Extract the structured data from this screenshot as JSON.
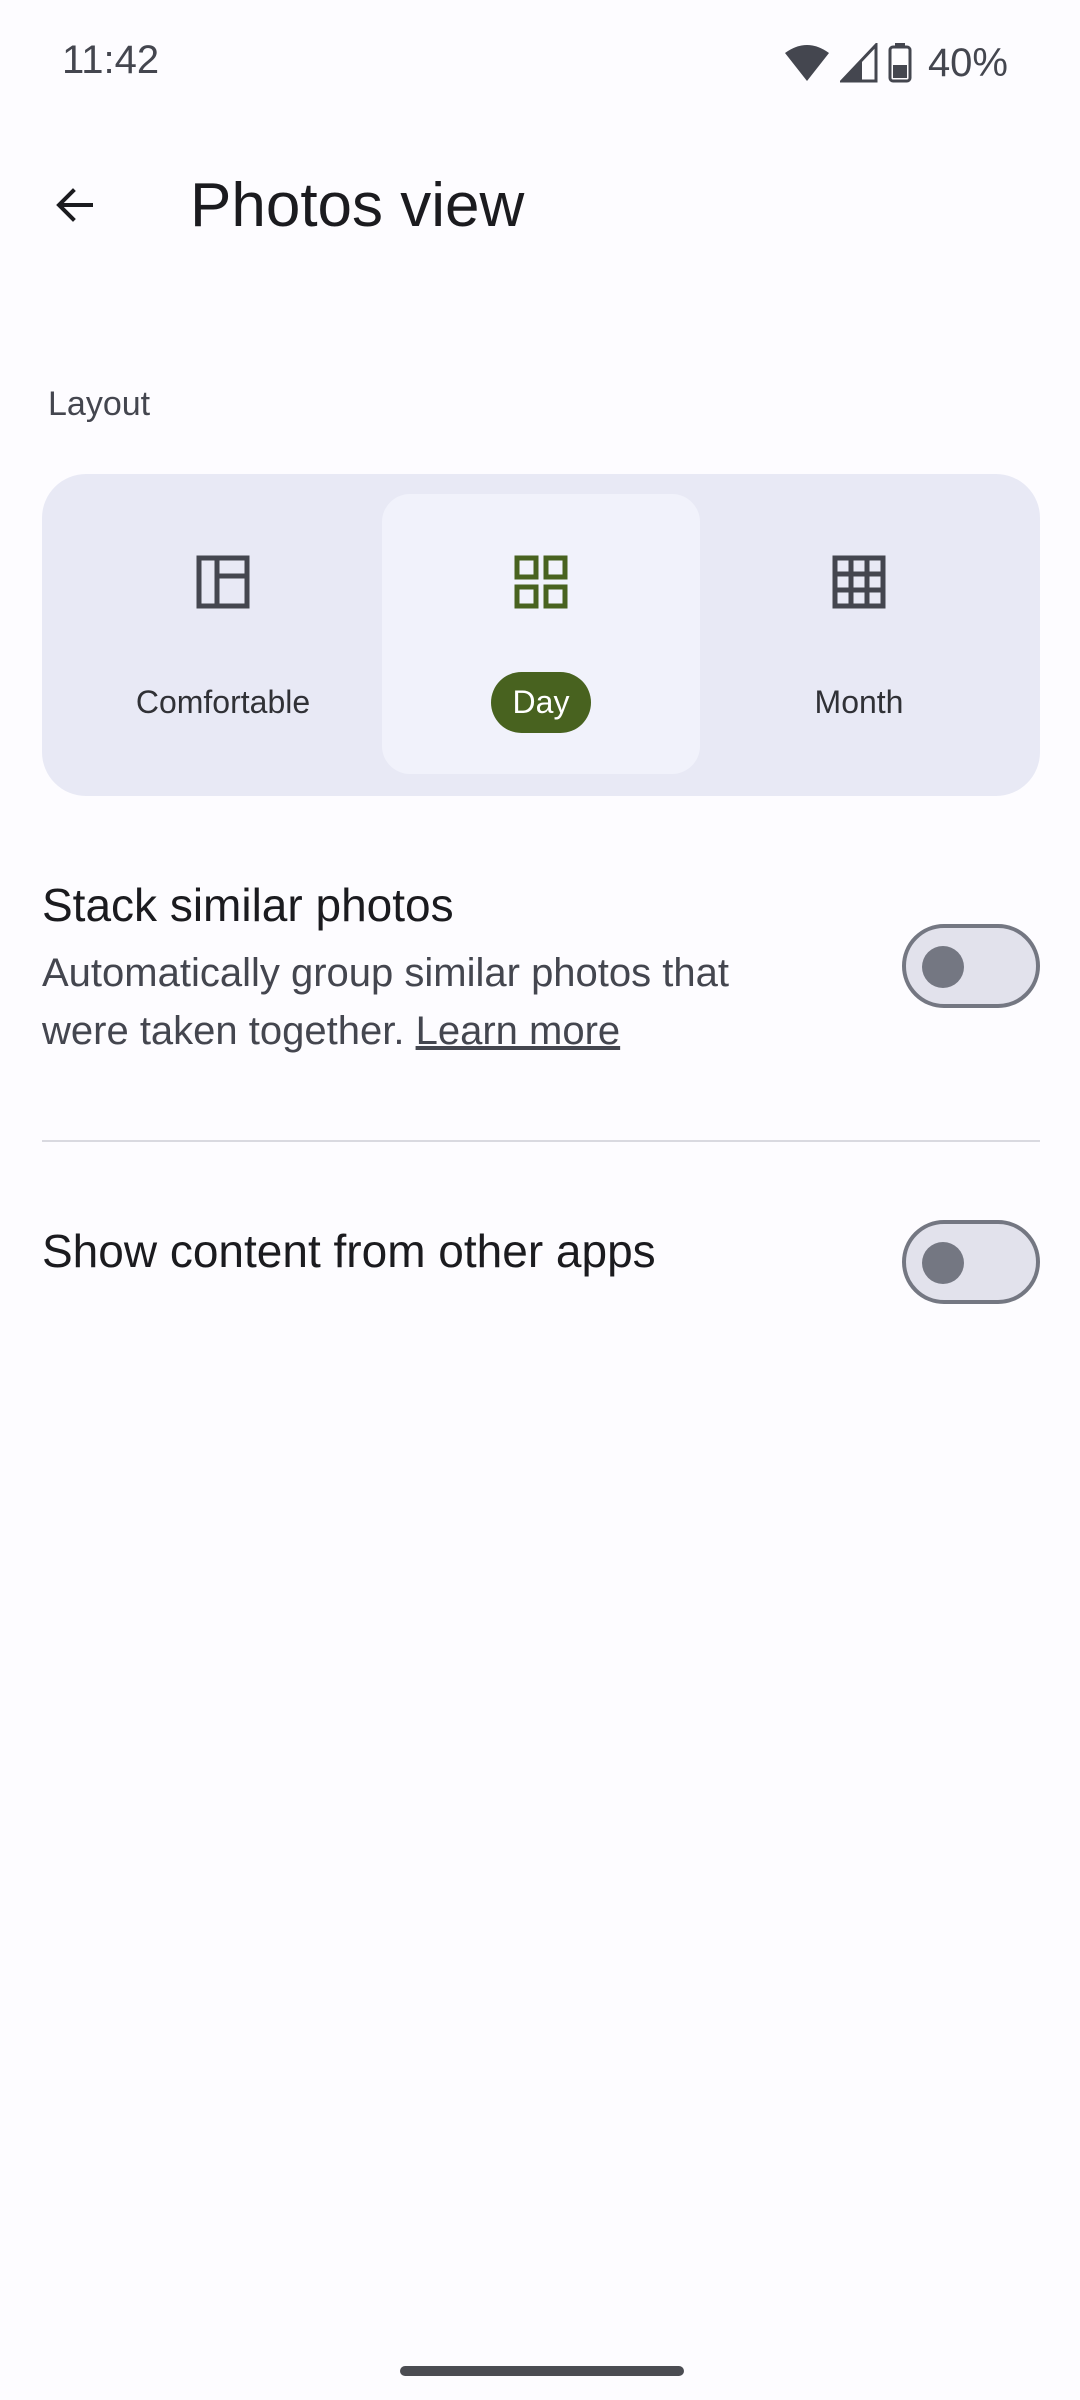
{
  "status_bar": {
    "time": "11:42",
    "battery": "40%"
  },
  "header": {
    "title": "Photos view",
    "back_icon": "arrow-back-icon"
  },
  "layout_section": {
    "label": "Layout",
    "options": [
      {
        "label": "Comfortable",
        "icon": "comfortable-layout-icon",
        "selected": false
      },
      {
        "label": "Day",
        "icon": "day-grid-icon",
        "selected": true
      },
      {
        "label": "Month",
        "icon": "month-grid-icon",
        "selected": false
      }
    ]
  },
  "settings": {
    "stack_similar": {
      "title": "Stack similar photos",
      "description": "Automatically group similar photos that were taken together.",
      "link": "Learn more",
      "enabled": false
    },
    "other_apps": {
      "title": "Show content from other apps",
      "enabled": false
    }
  },
  "colors": {
    "accent": "#48621f",
    "card_bg": "#e8e9f5",
    "selected_bg": "#f1f2fb"
  }
}
